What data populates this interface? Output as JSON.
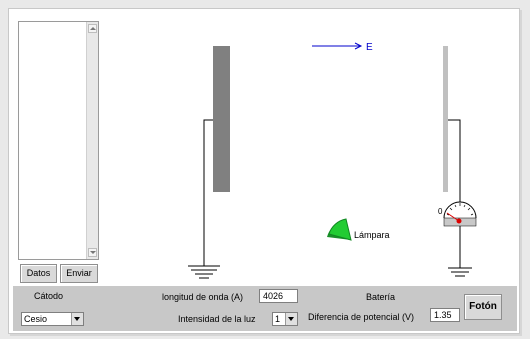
{
  "left_panel": {
    "datos_label": "Datos",
    "enviar_label": "Enviar"
  },
  "controls": {
    "catodo_label": "Cátodo",
    "catodo_value": "Cesio",
    "wavelength_label": "longitud de onda (A)",
    "wavelength_value": "4026",
    "intensity_label": "Intensidad de la luz",
    "intensity_value": "1",
    "bateria_label": "Batería",
    "potential_label": "Diferencia de potencial (V)",
    "potential_value": "1.35",
    "foton_label": "Fotón"
  },
  "scene": {
    "field_label": "E",
    "lamp_label": "Lámpara",
    "meter_reading": "0",
    "colors": {
      "cathode": "#808080",
      "anode": "#c0c0c0",
      "field_arrow": "#0000cc",
      "lamp": "#22cc33",
      "needle": "#dd0000"
    }
  }
}
